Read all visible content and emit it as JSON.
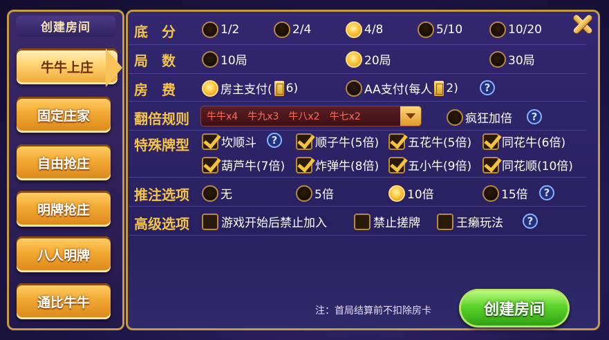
{
  "left": {
    "title": "创建房间",
    "modes": [
      "牛牛上庄",
      "固定庄家",
      "自由抢庄",
      "明牌抢庄",
      "八人明牌",
      "通比牛牛"
    ]
  },
  "rows": {
    "base": {
      "label": "底　分",
      "options": [
        "1/2",
        "2/4",
        "4/8",
        "5/10",
        "10/20"
      ],
      "selected": 2
    },
    "rounds": {
      "label": "局　数",
      "options": [
        "10局",
        "20局",
        "30局"
      ],
      "selected": 1
    },
    "fee": {
      "label": "房　费",
      "host_pay": "房主支付(",
      "host_count": "6)",
      "aa_pay": "AA支付(每人",
      "aa_count": "2)"
    },
    "double": {
      "label": "翻倍规则",
      "value": "牛牛x4　牛九x3　牛八x2　牛七x2",
      "crazy": "疯狂加倍"
    },
    "special": {
      "label": "特殊牌型",
      "items": [
        "坎顺斗",
        "顺子牛(5倍)",
        "五花牛(5倍)",
        "同花牛(6倍)",
        "葫芦牛(7倍)",
        "炸弹牛(8倍)",
        "五小牛(9倍)",
        "同花顺(10倍)"
      ]
    },
    "push": {
      "label": "推注选项",
      "options": [
        "无",
        "5倍",
        "10倍",
        "15倍"
      ],
      "selected": 2
    },
    "advanced": {
      "label": "高级选项",
      "options": [
        "游戏开始后禁止加入",
        "禁止搓牌",
        "王癞玩法"
      ]
    }
  },
  "footer": {
    "note": "注：首局结算前不扣除房卡",
    "create": "创建房间"
  },
  "help_glyph": "?",
  "colors": {
    "gold": "#f3c34a",
    "green": "#5bd42b"
  }
}
